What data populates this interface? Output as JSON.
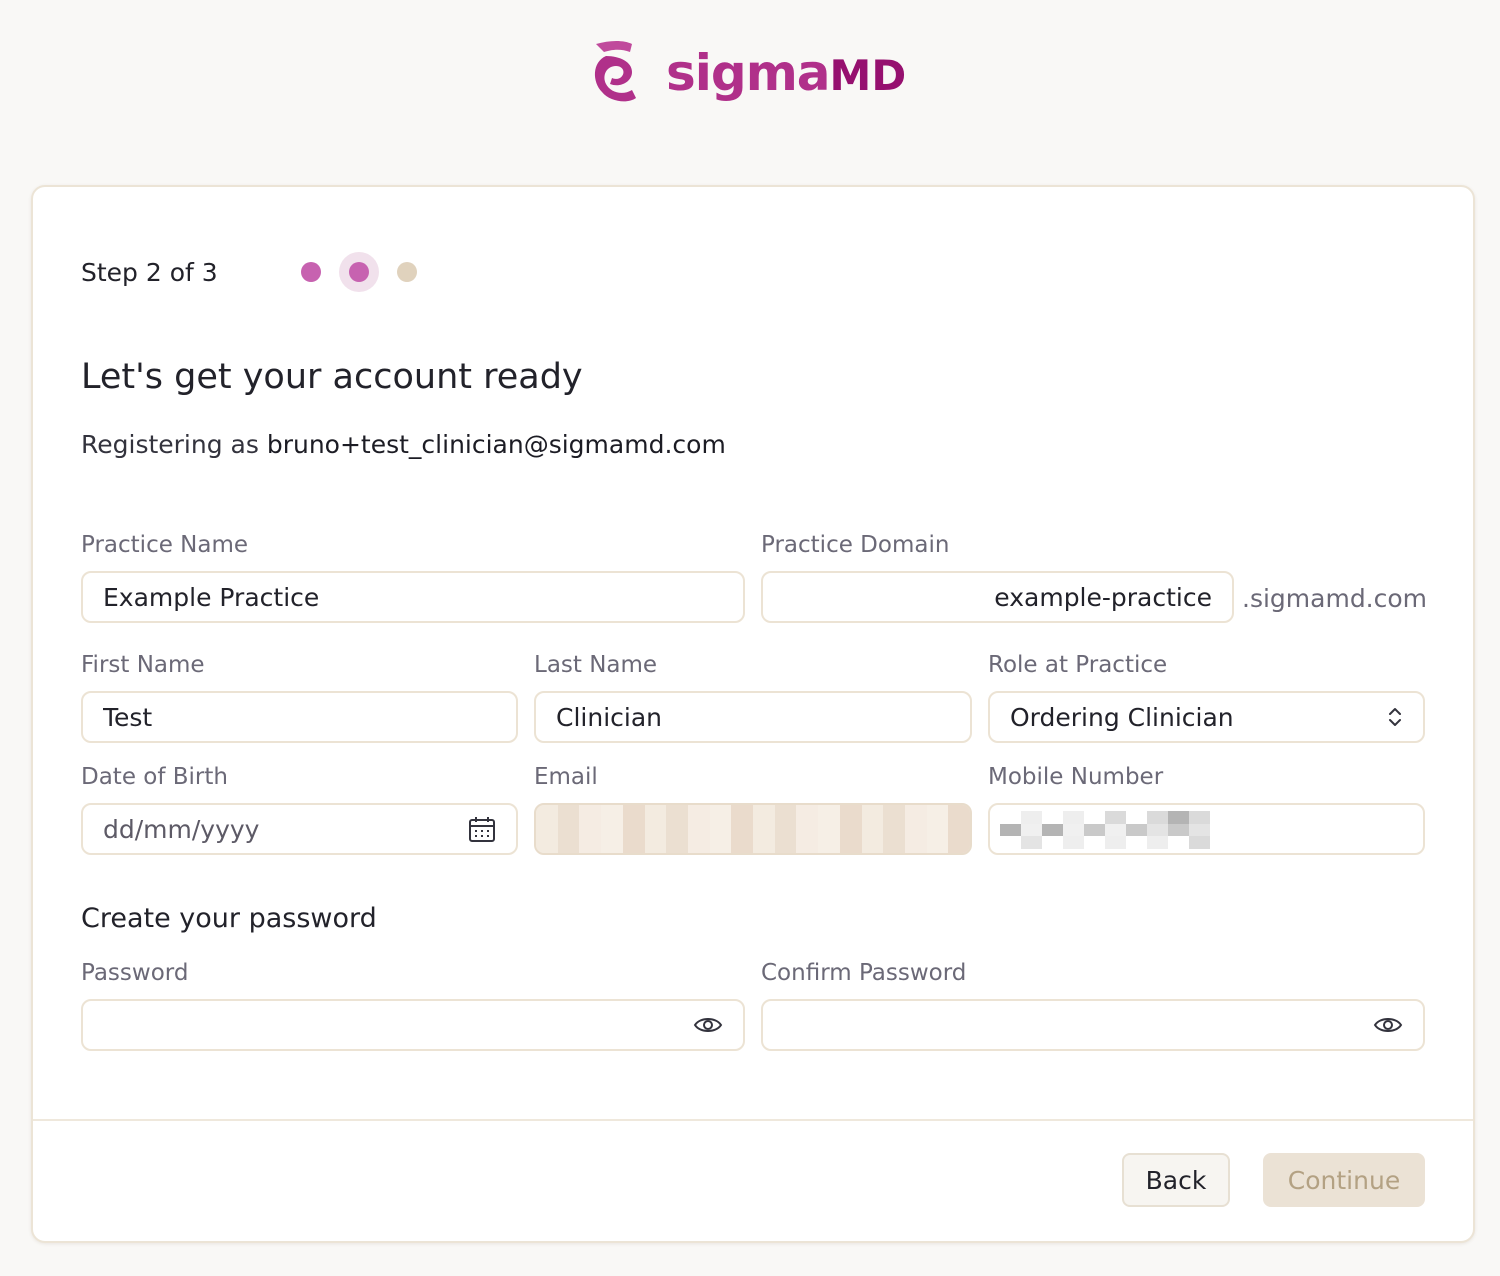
{
  "brand": {
    "name_prefix": "sigma",
    "name_suffix": "MD",
    "primary_color": "#b0308a",
    "dark_color": "#96106f"
  },
  "stepper": {
    "text": "Step 2 of 3",
    "total_steps": 3,
    "current_step": 2
  },
  "heading": {
    "title": "Let's get your account ready",
    "registering_prefix": "Registering as",
    "registering_email": "bruno+test_clinician@sigmamd.com"
  },
  "form": {
    "practice_name": {
      "label": "Practice Name",
      "value": "Example Practice"
    },
    "practice_domain": {
      "label": "Practice Domain",
      "value": "example-practice",
      "suffix": ".sigmamd.com"
    },
    "first_name": {
      "label": "First Name",
      "value": "Test"
    },
    "last_name": {
      "label": "Last Name",
      "value": "Clinician"
    },
    "role": {
      "label": "Role at Practice",
      "value": "Ordering Clinician"
    },
    "date_of_birth": {
      "label": "Date of Birth",
      "placeholder": "dd/mm/yyyy"
    },
    "email": {
      "label": "Email"
    },
    "mobile_number": {
      "label": "Mobile Number"
    }
  },
  "password_section": {
    "title": "Create your password",
    "password": {
      "label": "Password",
      "value": ""
    },
    "confirm_password": {
      "label": "Confirm Password",
      "value": ""
    }
  },
  "actions": {
    "back_label": "Back",
    "continue_label": "Continue"
  },
  "icons": {
    "logo": "sigma-logo-icon",
    "calendar": "calendar-icon",
    "select": "chevron-up-down-icon",
    "show_password": "eye-icon"
  }
}
